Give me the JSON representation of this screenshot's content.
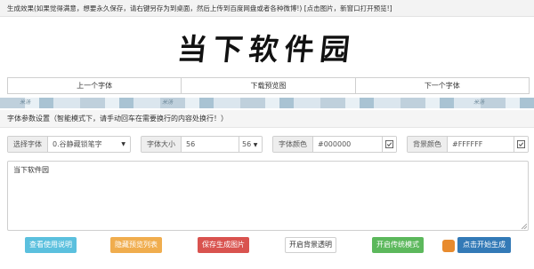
{
  "top_note": "生成效果(如果觉得满意，想要永久保存，请右键另存为到桌面，然后上传到百度网盘或者各种微博!) [点击图片，新窗口打开预览!]",
  "preview_text": "当下软件园",
  "nav": {
    "prev": "上一个字体",
    "download": "下载预览图",
    "next": "下一个字体"
  },
  "stripe_labels": [
    "米汤",
    "米汤",
    "米汤"
  ],
  "section_title": "字体参数设置（智能模式下，请手动回车在需要换行的内容处换行！）",
  "controls": {
    "font_label": "选择字体",
    "font_value": "0.谷静藏锁笔字",
    "size_label": "字体大小",
    "size_value": "56",
    "size_select": "56",
    "color_label": "字体颜色",
    "color_value": "#000000",
    "bg_label": "背景颜色",
    "bg_value": "#FFFFFF"
  },
  "textarea_value": "当下软件园",
  "actions": {
    "help": "查看使用说明",
    "hide_list": "隐藏预览列表",
    "save": "保存生成图片",
    "transparent": "开启背景透明",
    "traditional": "开启传统模式",
    "generate": "点击开始生成"
  },
  "colors": {
    "info": "#5bc0de",
    "warning": "#f0ad4e",
    "danger": "#d9534f",
    "success": "#5cb85c",
    "primary": "#337ab7"
  }
}
